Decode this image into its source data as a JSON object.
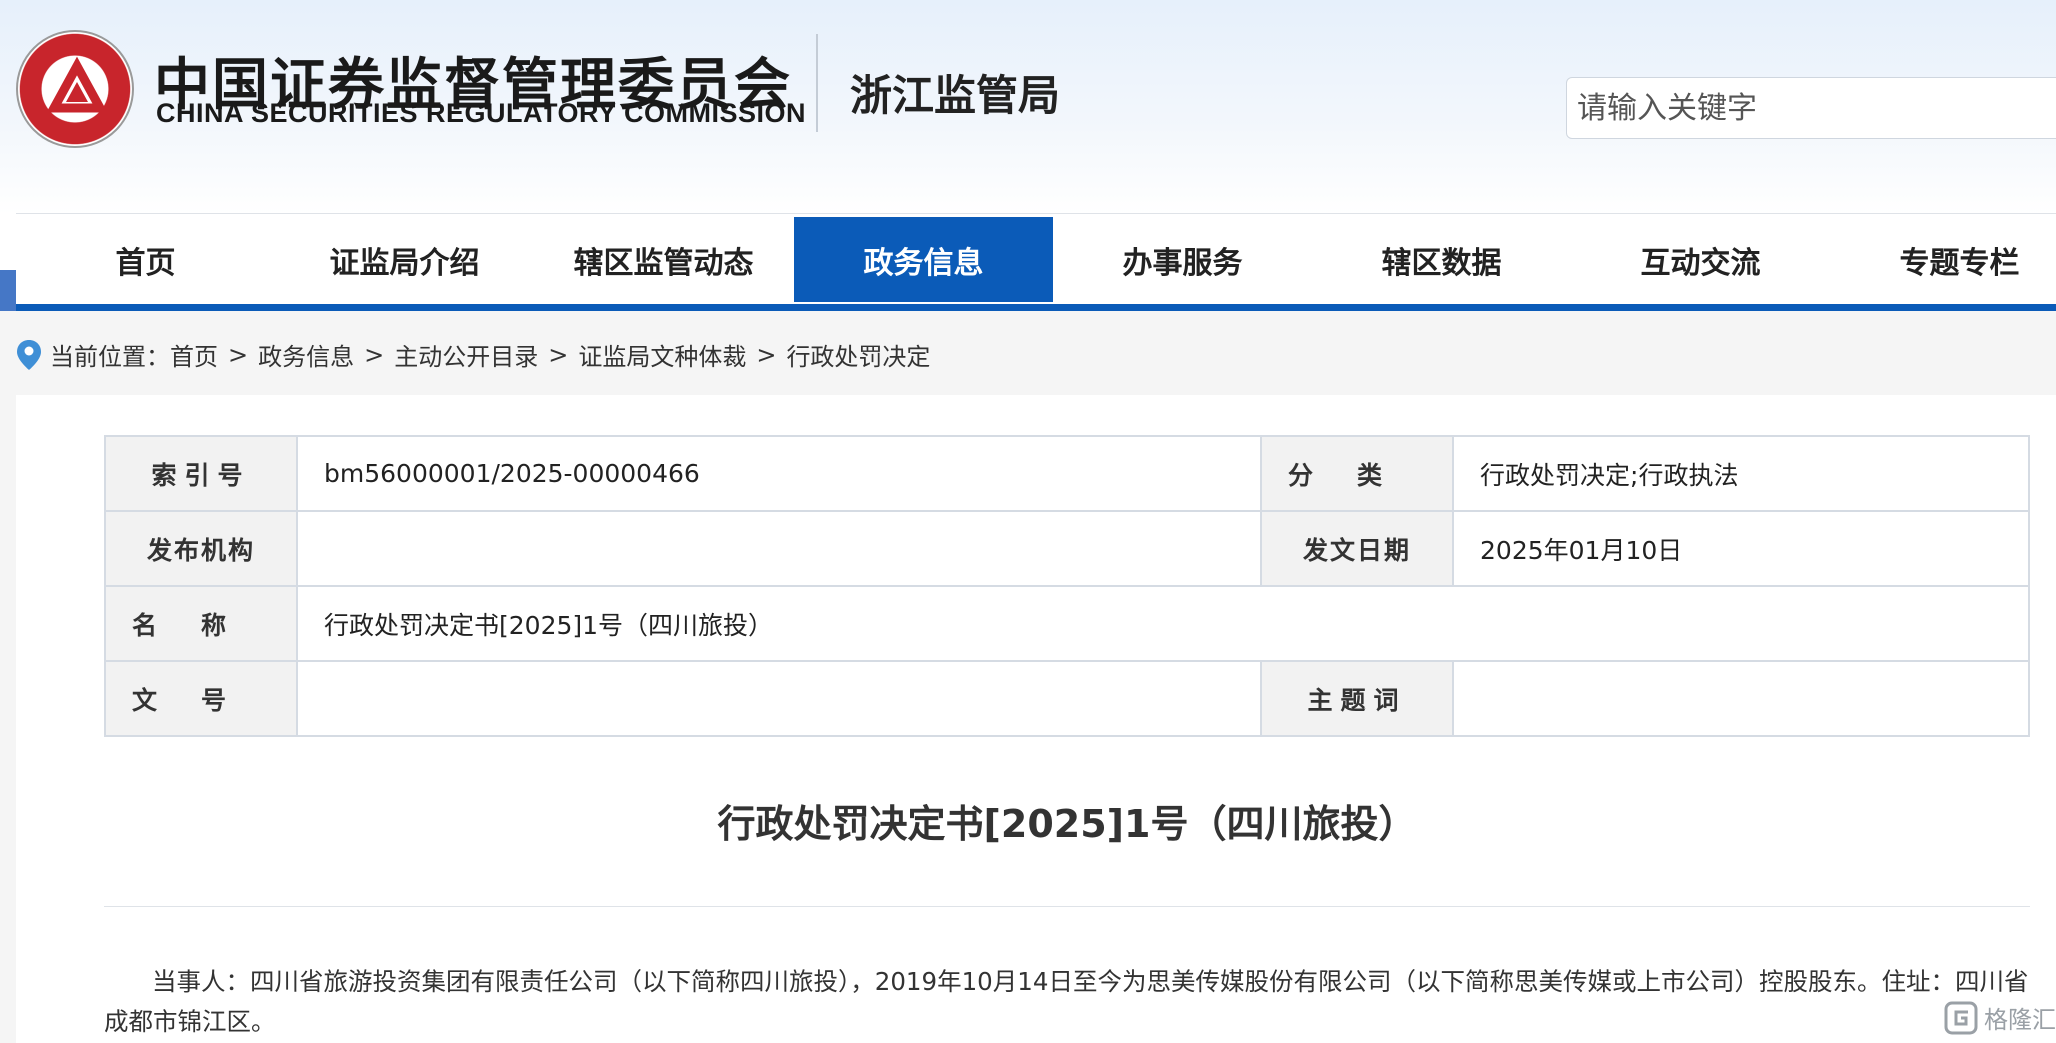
{
  "header": {
    "logo_cn": "中国证券监督管理委员会",
    "logo_en": "CHINA SECURITIES REGULATORY COMMISSION",
    "bureau": "浙江监管局",
    "search_placeholder": "请输入关键字"
  },
  "nav": {
    "items": [
      "首页",
      "证监局介绍",
      "辖区监管动态",
      "政务信息",
      "办事服务",
      "辖区数据",
      "互动交流",
      "专题专栏"
    ],
    "active": "政务信息"
  },
  "breadcrumb": {
    "prefix": "当前位置：",
    "items": [
      "首页",
      "政务信息",
      "主动公开目录",
      "证监局文种体裁",
      "行政处罚决定"
    ],
    "separator": ">"
  },
  "meta": {
    "index_label": "索引号",
    "index_value": "bm56000001/2025-00000466",
    "category_label": "分类",
    "category_value": "行政处罚决定;行政执法",
    "publisher_label": "发布机构",
    "publisher_value": "",
    "date_label": "发文日期",
    "date_value": "2025年01月10日",
    "name_label": "名称",
    "name_value": "行政处罚决定书[2025]1号（四川旅投）",
    "docno_label": "文号",
    "docno_value": "",
    "keywords_label": "主题词",
    "keywords_value": ""
  },
  "document": {
    "title": "行政处罚决定书[2025]1号（四川旅投）",
    "paragraph_1": "当事人：四川省旅游投资集团有限责任公司（以下简称四川旅投），2019年10月14日至今为思美传媒股份有限公司（以下简称思美传媒或上市公司）控股股东。住址：四川省成都市锦江区。"
  },
  "watermark": "格隆汇",
  "colors": {
    "primary": "#0b5bb8",
    "seal_red": "#c8252c"
  }
}
